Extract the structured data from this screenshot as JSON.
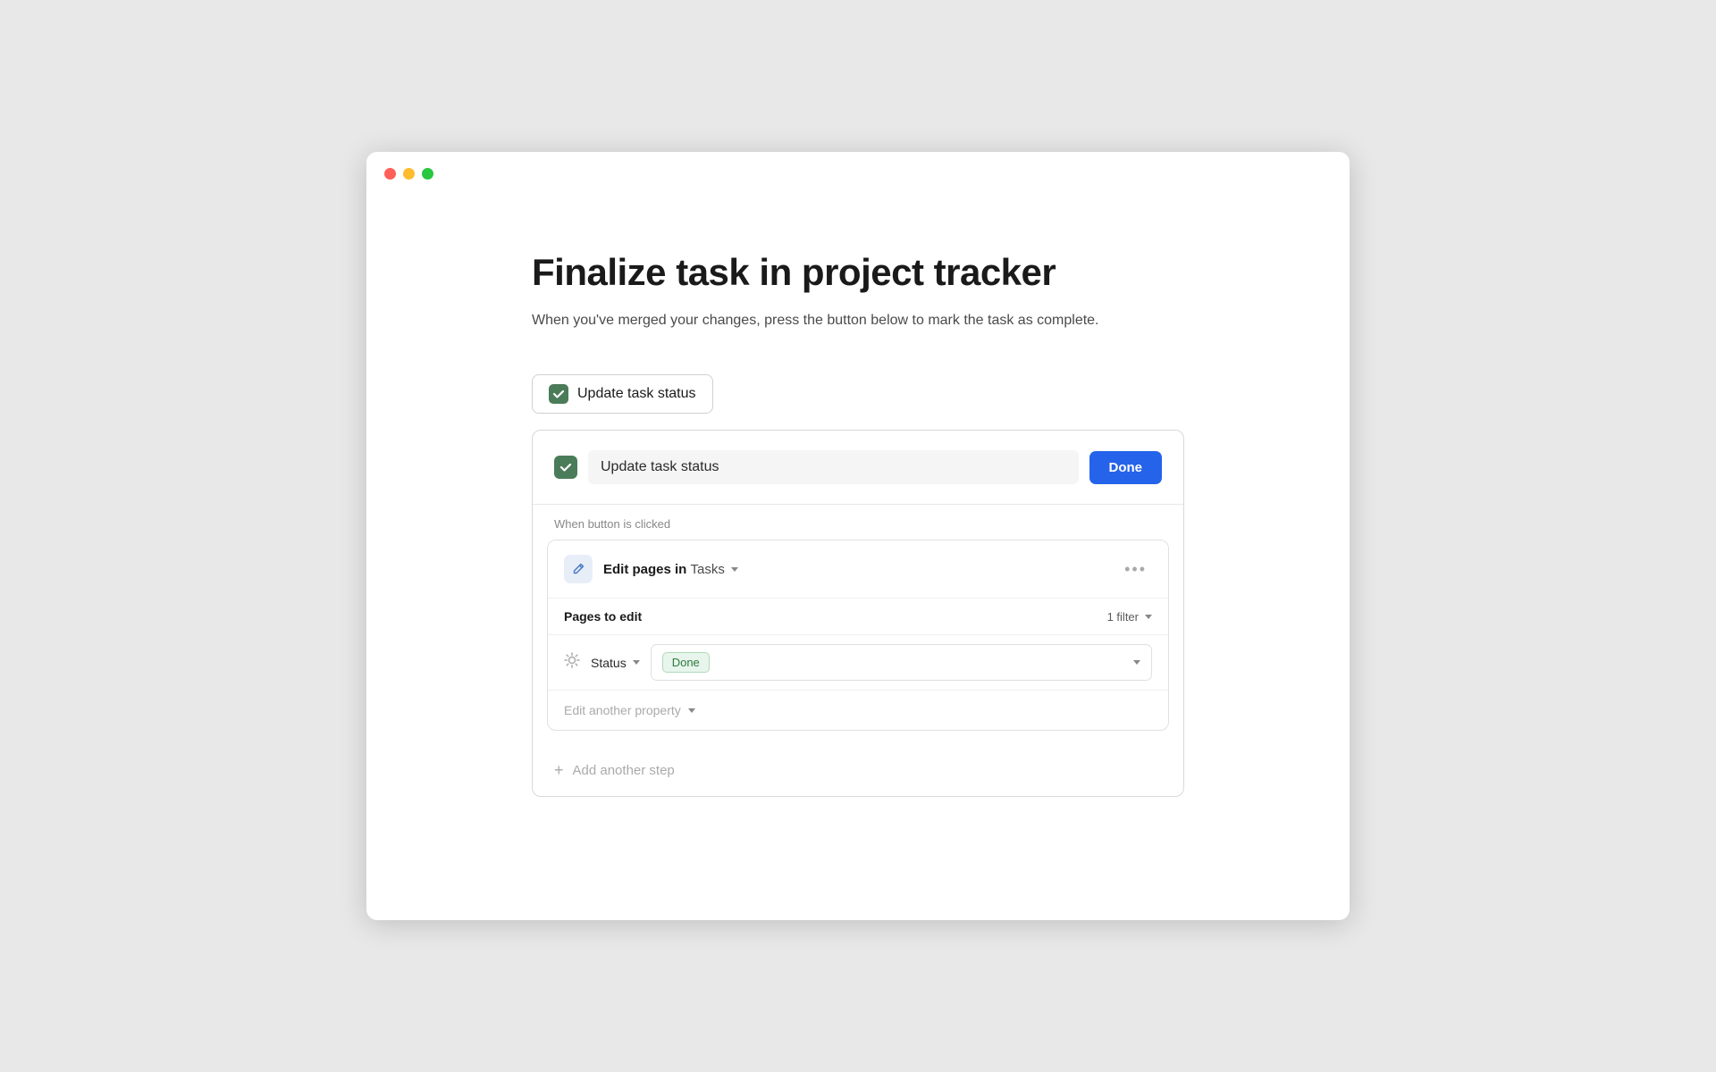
{
  "window": {
    "title": "Finalize task in project tracker"
  },
  "page": {
    "title": "Finalize task in project tracker",
    "subtitle": "When you've merged your changes, press the button below to mark the task as complete.",
    "toggle_button_label": "Update task status",
    "card": {
      "task_input_value": "Update task status",
      "done_button_label": "Done",
      "when_label": "When button is clicked",
      "action": {
        "title_prefix": "Edit pages in",
        "db_name": "Tasks",
        "more_icon": "···",
        "pages_label": "Pages to edit",
        "filter_label": "1 filter",
        "status_label": "Status",
        "status_value": "Done",
        "edit_property_label": "Edit another property",
        "add_step_label": "Add another step"
      }
    }
  },
  "icons": {
    "checkmark": "✓",
    "pencil": "✏",
    "sun": "✳",
    "plus": "+",
    "ellipsis": "•••"
  }
}
